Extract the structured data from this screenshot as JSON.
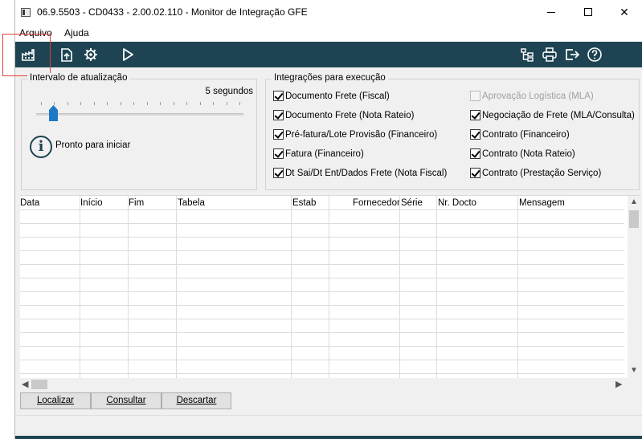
{
  "window": {
    "title": "06.9.5503 - CD0433 - 2.00.02.110 - Monitor de Integração GFE",
    "minimize": "—",
    "maximize": "☐",
    "close": "✕"
  },
  "menu": {
    "items": [
      "Arquivo",
      "Ajuda"
    ]
  },
  "toolbar": {
    "left_icons": [
      "factory-icon",
      "upload-icon",
      "gear-icon",
      "play-icon"
    ],
    "right_icons": [
      "tree-icon",
      "printer-icon",
      "exit-icon",
      "help-icon"
    ],
    "color": "#1e4352"
  },
  "interval": {
    "title": "Intervalo de atualização",
    "value_label": "5 segundos",
    "slider_fraction": 0.05,
    "status_text": "Pronto para iniciar"
  },
  "integrations": {
    "title": "Integrações para execução",
    "left": [
      {
        "label": "Documento Frete (Fiscal)",
        "checked": true,
        "enabled": true
      },
      {
        "label": "Documento Frete (Nota Rateio)",
        "checked": true,
        "enabled": true
      },
      {
        "label": "Pré-fatura/Lote Provisão (Financeiro)",
        "checked": true,
        "enabled": true
      },
      {
        "label": "Fatura (Financeiro)",
        "checked": true,
        "enabled": true
      },
      {
        "label": "Dt Sai/Dt Ent/Dados Frete (Nota Fiscal)",
        "checked": true,
        "enabled": true
      }
    ],
    "right": [
      {
        "label": "Aprovação Logística (MLA)",
        "checked": false,
        "enabled": false
      },
      {
        "label": "Negociação de Frete (MLA/Consulta)",
        "checked": true,
        "enabled": true
      },
      {
        "label": "Contrato (Financeiro)",
        "checked": true,
        "enabled": true
      },
      {
        "label": "Contrato (Nota Rateio)",
        "checked": true,
        "enabled": true
      },
      {
        "label": "Contrato (Prestação Serviço)",
        "checked": true,
        "enabled": true
      }
    ]
  },
  "table": {
    "columns": [
      "Data",
      "Início",
      "Fim",
      "Tabela",
      "Estab",
      "Fornecedor",
      "Série",
      "Nr. Docto",
      "Mensagem"
    ],
    "rows": []
  },
  "buttons": {
    "localizar": "Localizar",
    "consultar": "Consultar",
    "descartar": "Descartar"
  }
}
